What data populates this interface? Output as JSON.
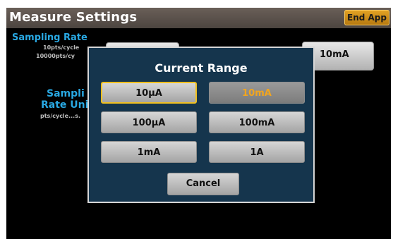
{
  "header": {
    "title": "Measure Settings",
    "end_app_label": "End App"
  },
  "background": {
    "sampling_rate_label": "Sampling Rate",
    "sampling_rate_line1": "10pts/cycle",
    "sampling_rate_line2": "10000pts/cy",
    "sampling_rate_units_label_line1": "Sampli",
    "sampling_rate_units_label_line2": "Rate Uni",
    "sampling_rate_units_value": "pts/cycle...s.",
    "current_range_value": "10mA"
  },
  "dialog": {
    "title": "Current Range",
    "options": [
      "10µA",
      "10mA",
      "100µA",
      "100mA",
      "1mA",
      "1A"
    ],
    "selected": "10µA",
    "current": "10mA",
    "cancel_label": "Cancel"
  },
  "colors": {
    "accent": "#29a8e2",
    "end_app": "#d9961b",
    "highlight": "#f0c020",
    "dialog_bg": "#15354d"
  }
}
